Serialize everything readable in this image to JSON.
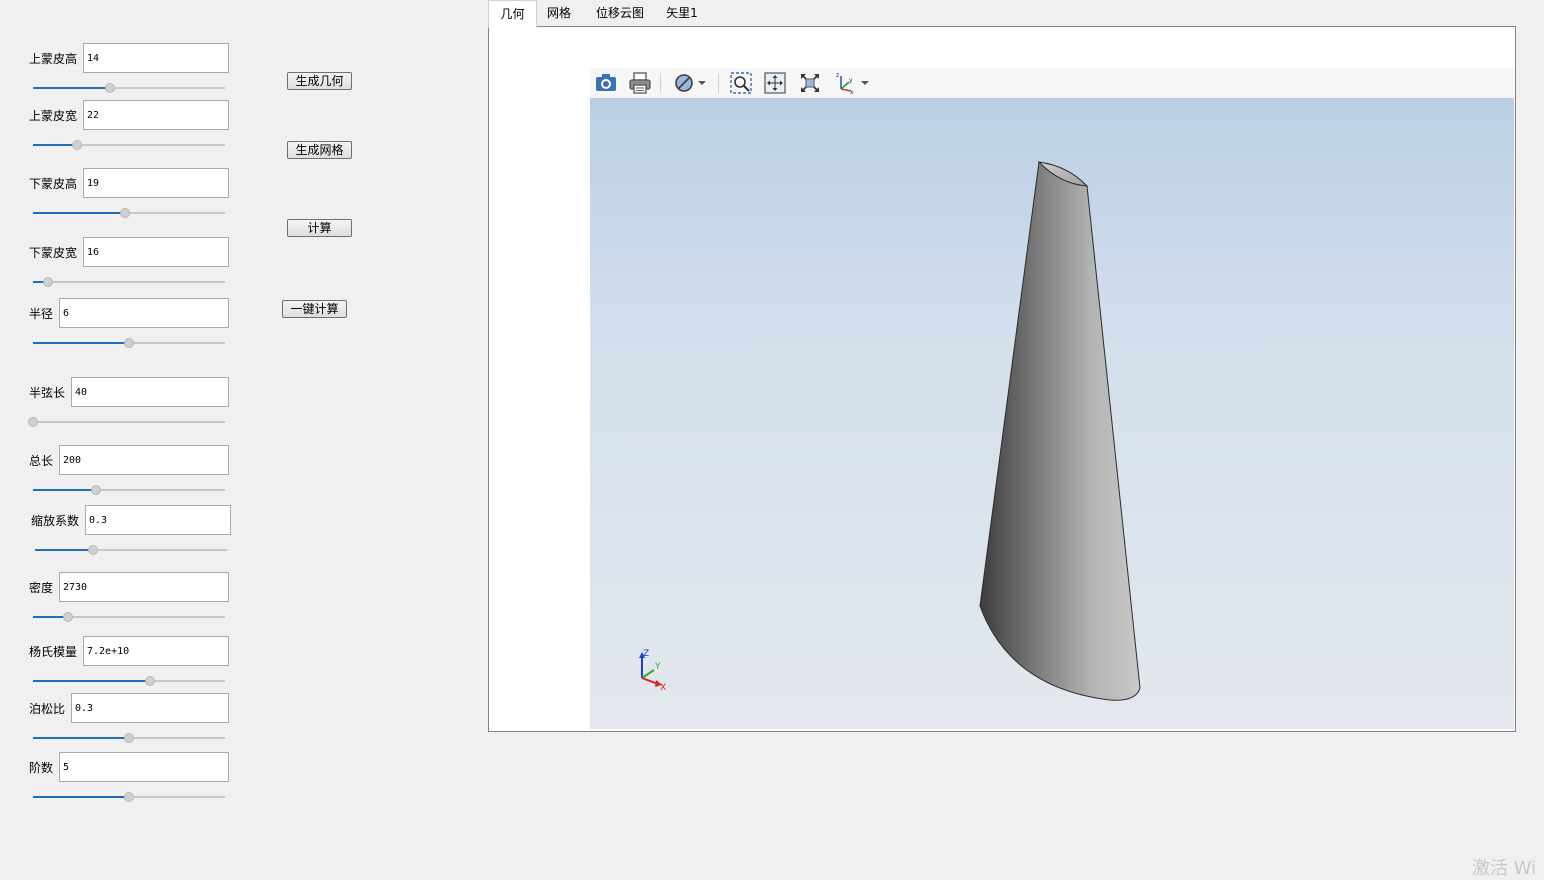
{
  "params": [
    {
      "label": "上蒙皮高",
      "value": "14",
      "slider": 0.4
    },
    {
      "label": "上蒙皮宽",
      "value": "22",
      "slider": 0.23
    },
    {
      "label": "下蒙皮高",
      "value": "19",
      "slider": 0.48
    },
    {
      "label": "下蒙皮宽",
      "value": "16",
      "slider": 0.08
    },
    {
      "label": "半径",
      "value": "6",
      "slider": 0.5
    },
    {
      "label": "半弦长",
      "value": "40",
      "slider": 0.0
    },
    {
      "label": "总长",
      "value": "200",
      "slider": 0.33
    },
    {
      "label": "缩放系数",
      "value": "0.3",
      "slider": 0.3
    },
    {
      "label": "密度",
      "value": "2730",
      "slider": 0.18
    },
    {
      "label": "杨氏模量",
      "value": "7.2e+10",
      "slider": 0.61
    },
    {
      "label": "泊松比",
      "value": "0.3",
      "slider": 0.5
    },
    {
      "label": "阶数",
      "value": "5",
      "slider": 0.5
    }
  ],
  "buttons": {
    "generate_geometry": "生成几何",
    "generate_mesh": "生成网格",
    "compute": "计算",
    "one_click_compute": "一键计算"
  },
  "tabs": [
    "几何",
    "网格",
    "位移云图",
    "矢里1"
  ],
  "active_tab": 0,
  "toolbar_icons": [
    "camera-icon",
    "print-icon",
    "view-mode-icon",
    "zoom-box-icon",
    "pan-icon",
    "fit-all-icon",
    "axes-orientation-icon"
  ],
  "axes": {
    "z": "Z",
    "y": "Y",
    "x": "X"
  },
  "watermark": "激活 Wi",
  "colors": {
    "slider_fill": "#1e6fbf",
    "viewport_top": "#b8cde3",
    "viewport_bottom": "#e4e8ee",
    "shape_dark": "#4a4a4a",
    "shape_light": "#c4c4c4"
  }
}
